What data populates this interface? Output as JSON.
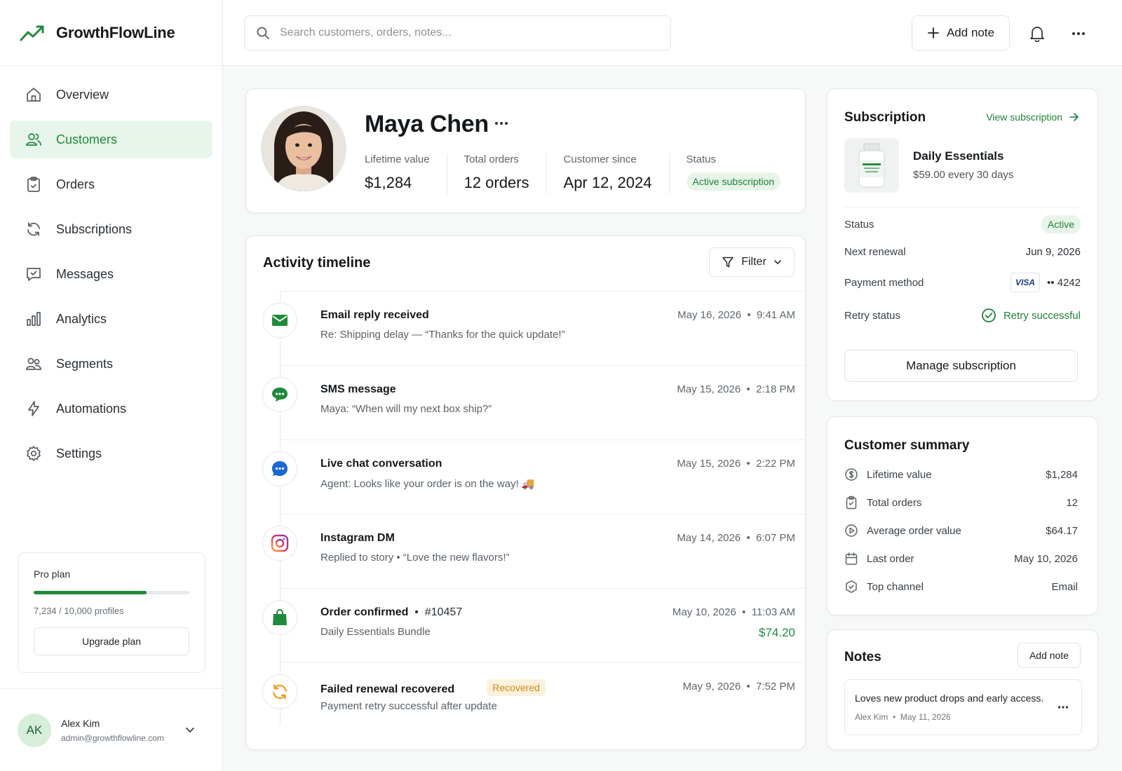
{
  "brand": {
    "name": "GrowthFlowLine",
    "accent": "#1f8a3b"
  },
  "sidebar": {
    "items": [
      {
        "label": "Overview",
        "icon": "home-icon",
        "active": false
      },
      {
        "label": "Customers",
        "icon": "users-icon",
        "active": true
      },
      {
        "label": "Orders",
        "icon": "clipboard-icon",
        "active": false
      },
      {
        "label": "Subscriptions",
        "icon": "refresh-icon",
        "active": false
      },
      {
        "label": "Messages",
        "icon": "message-icon",
        "active": false
      },
      {
        "label": "Analytics",
        "icon": "bar-chart-icon",
        "active": false
      },
      {
        "label": "Segments",
        "icon": "segments-icon",
        "active": false
      },
      {
        "label": "Automations",
        "icon": "lightning-icon",
        "active": false
      },
      {
        "label": "Settings",
        "icon": "gear-icon",
        "active": false
      }
    ],
    "plan": {
      "title": "Pro plan",
      "usage_fraction": 0.7234,
      "count": "7,234 / 10,000 profiles",
      "upgrade_label": "Upgrade plan"
    },
    "user": {
      "initials": "AK",
      "name": "Alex Kim",
      "email": "admin@growthflowline.com"
    }
  },
  "topbar": {
    "search_placeholder": "Search customers, orders, notes...",
    "add_note_label": "Add note"
  },
  "profile": {
    "name": "Maya Chen",
    "stats": {
      "lifetime_label": "Lifetime value",
      "lifetime_value": "$1,284",
      "orders_label": "Total orders",
      "orders_value": "12 orders",
      "since_label": "Customer since",
      "since_value": "Apr 12, 2024",
      "status_label": "Status",
      "status_value": "Active subscription"
    }
  },
  "activity": {
    "title": "Activity timeline",
    "filter_label": "Filter",
    "items": [
      {
        "title": "Email reply received",
        "subtitle": "Re: Shipping delay — “Thanks for the quick update!”",
        "date": "May 16, 2026  •  9:41 AM",
        "icon": "mail-icon"
      },
      {
        "title": "SMS message",
        "subtitle": "Maya: “When will my next box ship?”",
        "date": "May 15, 2026  •  2:18 PM",
        "icon": "sms-icon"
      },
      {
        "title": "Live chat conversation",
        "subtitle": "Agent: Looks like your order is on the way! 🚚",
        "date": "May 15, 2026  •  2:22 PM",
        "icon": "chat-icon"
      },
      {
        "title": "Instagram DM",
        "subtitle": "Replied to story  •  “Love the new flavors!”",
        "date": "May 14, 2026  •  6:07 PM",
        "icon": "instagram-icon"
      },
      {
        "title": "Order confirmed",
        "title_extra": "  •  #10457",
        "subtitle": "Daily Essentials Bundle",
        "date": "May 10, 2026  •  11:03 AM",
        "amount": "$74.20",
        "icon": "shopping-bag-icon"
      },
      {
        "title": "Failed renewal recovered",
        "badge": "Recovered",
        "subtitle": "Payment retry successful after update",
        "date": "May 9, 2026  •  7:52 PM",
        "icon": "refresh-icon"
      }
    ]
  },
  "subscription": {
    "title": "Subscription",
    "view_link": "View subscription",
    "product_name": "Daily Essentials",
    "product_price": "$59.00 every 30 days",
    "status_label": "Status",
    "status_value": "Active",
    "renewal_label": "Next renewal",
    "renewal_value": "Jun 9, 2026",
    "payment_label": "Payment method",
    "card_brand": "VISA",
    "card_last4": "•• 4242",
    "retry_label": "Retry status",
    "retry_value": "Retry successful",
    "manage_label": "Manage subscription"
  },
  "summary": {
    "title": "Customer summary",
    "rows": [
      {
        "label": "Lifetime value",
        "value": "$1,284",
        "icon": "dollar-icon"
      },
      {
        "label": "Total orders",
        "value": "12",
        "icon": "clipboard-icon"
      },
      {
        "label": "Average order value",
        "value": "$64.17",
        "icon": "play-circle-icon"
      },
      {
        "label": "Last order",
        "value": "May 10, 2026",
        "icon": "calendar-icon"
      },
      {
        "label": "Top channel",
        "value": "Email",
        "icon": "badge-icon"
      }
    ]
  },
  "notes": {
    "title": "Notes",
    "add_label": "Add note",
    "items": [
      {
        "text": "Loves new product drops and early access.",
        "meta": "Alex Kim  •  May 11, 2026"
      }
    ]
  }
}
